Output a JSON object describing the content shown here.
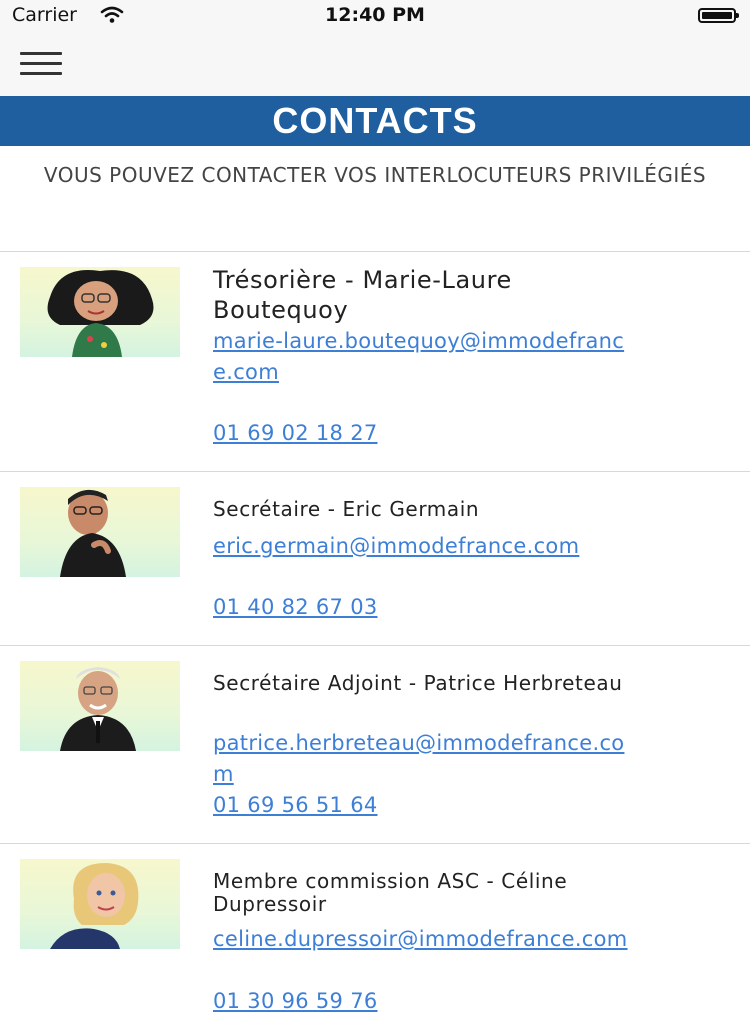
{
  "status_bar": {
    "carrier": "Carrier",
    "time": "12:40 PM"
  },
  "header": {
    "title": "CONTACTS"
  },
  "intro": {
    "text": "VOUS POUVEZ CONTACTER VOS INTERLOCUTEURS PRIVILÉGIÉS"
  },
  "contacts": [
    {
      "title": "Trésorière - Marie-Laure Boutequoy",
      "email": "marie-laure.boutequoy@immodefrance.com",
      "phone": "01 69 02 18 27"
    },
    {
      "title": "Secrétaire - Eric Germain",
      "email": "eric.germain@immodefrance.com",
      "phone": "01 40 82 67 03"
    },
    {
      "title": "Secrétaire Adjoint - Patrice Herbreteau",
      "email": "patrice.herbreteau@immodefrance.com",
      "phone": "01 69 56 51 64"
    },
    {
      "title": "Membre commission ASC - Céline Dupressoir",
      "email": "celine.dupressoir@immodefrance.com",
      "phone": "01 30 96 59 76"
    }
  ],
  "colors": {
    "header_bg": "#1f5f9f",
    "link": "#3d7fd6"
  },
  "icons": {
    "menu": "hamburger-menu-icon",
    "wifi": "wifi-icon",
    "battery": "battery-icon"
  }
}
